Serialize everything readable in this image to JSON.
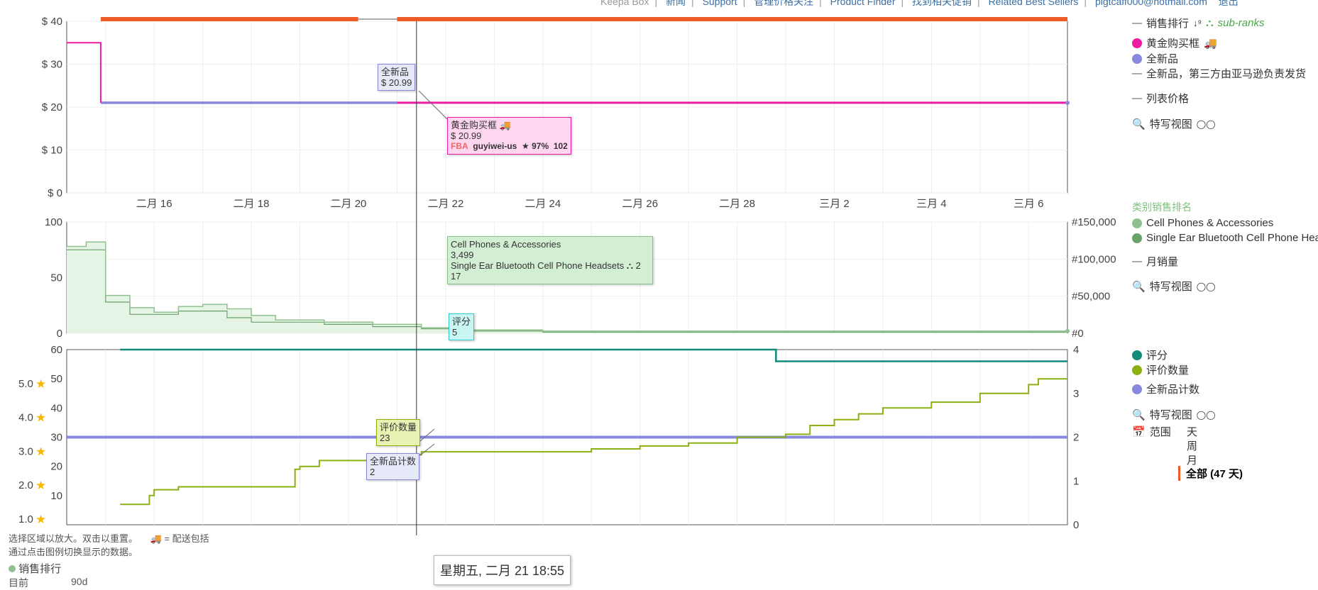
{
  "nav": {
    "items": [
      "Keepa Box",
      "新闻",
      "Support",
      "管理价格关注",
      "Product Finder",
      "找到相关促销",
      "Related Best Sellers",
      "pigtcaff000@hotmail.com",
      "退出"
    ]
  },
  "legend_price": {
    "sales_rank": "销售排行",
    "sub_ranks": "sub-ranks",
    "buy_box": "黄金购买框",
    "new": "全新品",
    "new_fba": "全新品，第三方由亚马逊负责发货",
    "list_price": "列表价格",
    "closeup": "特写视图"
  },
  "legend_rank": {
    "title": "类别销售排名",
    "cat1": "Cell Phones & Accessories",
    "cat2": "Single Ear Bluetooth Cell Phone Headsets",
    "monthly_sold": "月销量",
    "closeup": "特写视图"
  },
  "legend_rating": {
    "rating": "评分",
    "review_count": "评价数量",
    "new_offer_count": "全新品计数",
    "closeup": "特写视图",
    "range_label": "范围",
    "range_day": "天",
    "range_week": "周",
    "range_month": "月",
    "range_all": "全部 (47 天)"
  },
  "tooltips": {
    "new_title": "全新品",
    "new_price": "$ 20.99",
    "buybox_title": "黄金购买框",
    "buybox_price": "$ 20.99",
    "buybox_fba": "FBA",
    "buybox_seller": "guyiwei-us",
    "buybox_rating": "★ 97%",
    "buybox_count": "102",
    "rank_cat1": "Cell Phones & Accessories",
    "rank_cat1_value": "3,499",
    "rank_cat2": "Single Ear Bluetooth Cell Phone Headsets",
    "rank_cat2_badge": "2",
    "rank_cat2_value": "17",
    "rating_title": "评分",
    "rating_value": "5",
    "reviews_title": "评价数量",
    "reviews_value": "23",
    "offers_title": "全新品计数",
    "offers_value": "2",
    "date": "星期五, 二月 21 18:55"
  },
  "footer": {
    "hint1": "选择区域以放大。双击以重置。",
    "hint2": "= 配送包括",
    "hint3": "通过点击图例切换显示的数据。",
    "sales_rank": "销售排行",
    "current": "目前",
    "days90": "90d"
  },
  "colors": {
    "buy_box": "#ee1aa3",
    "new": "#8888dd",
    "amazon_bar": "#f05a28",
    "rank1": "#8fc18f",
    "rank2": "#6aa06a",
    "rating": "#138a7a",
    "review_count": "#8cb010",
    "offer_count": "#8888dd"
  },
  "chart_data": [
    {
      "type": "line",
      "title": "Price",
      "x_ticks": [
        "二月 16",
        "二月 18",
        "二月 20",
        "二月 22",
        "二月 24",
        "二月 26",
        "二月 28",
        "三月 2",
        "三月 4",
        "三月 6"
      ],
      "y_ticks": [
        "$ 0",
        "$ 10",
        "$ 20",
        "$ 30",
        "$ 40"
      ],
      "ylim": [
        0,
        40
      ],
      "xlim_days": [
        14.2,
        34.8
      ],
      "series": [
        {
          "name": "黄金购买框",
          "points": [
            [
              14.2,
              35
            ],
            [
              14.9,
              35
            ],
            [
              14.9,
              21
            ],
            [
              21,
              21
            ],
            [
              21.0,
              21
            ],
            [
              34.8,
              21
            ]
          ]
        },
        {
          "name": "全新品",
          "points": [
            [
              14.9,
              21
            ],
            [
              21,
              21
            ]
          ]
        }
      ],
      "amazon_bar_segments": [
        [
          14.9,
          20.2
        ],
        [
          21.0,
          34.8
        ]
      ]
    },
    {
      "type": "line",
      "title": "Sales Rank",
      "y_ticks_left": [
        "0",
        "50",
        "100"
      ],
      "y_ticks_right": [
        "#0",
        "#50,000",
        "#100,000",
        "#150,000"
      ],
      "ylim_left": [
        0,
        100
      ],
      "ylim_right": [
        0,
        150000
      ],
      "series": [
        {
          "name": "Cell Phones & Accessories",
          "points": [
            [
              14.2,
              78
            ],
            [
              14.6,
              78
            ],
            [
              14.6,
              82
            ],
            [
              15.0,
              82
            ],
            [
              15.0,
              34
            ],
            [
              15.5,
              34
            ],
            [
              15.5,
              23
            ],
            [
              16.0,
              23
            ],
            [
              16.0,
              19
            ],
            [
              16.5,
              19
            ],
            [
              16.5,
              24
            ],
            [
              17.0,
              24
            ],
            [
              17.0,
              26
            ],
            [
              17.5,
              26
            ],
            [
              17.5,
              22
            ],
            [
              18.0,
              22
            ],
            [
              18.0,
              16
            ],
            [
              18.5,
              16
            ],
            [
              18.5,
              12
            ],
            [
              19.5,
              12
            ],
            [
              19.5,
              10
            ],
            [
              20.5,
              10
            ],
            [
              20.5,
              8
            ],
            [
              21.5,
              8
            ],
            [
              21.5,
              5
            ],
            [
              22.5,
              5
            ],
            [
              22.5,
              3
            ],
            [
              24.0,
              3
            ],
            [
              24.0,
              2
            ],
            [
              34.8,
              2
            ]
          ]
        },
        {
          "name": "Single Ear Bluetooth Cell Phone Headsets",
          "points": [
            [
              14.2,
              75
            ],
            [
              15.0,
              75
            ],
            [
              15.0,
              28
            ],
            [
              15.5,
              28
            ],
            [
              15.5,
              17
            ],
            [
              16.5,
              17
            ],
            [
              16.5,
              20
            ],
            [
              17.5,
              20
            ],
            [
              17.5,
              14
            ],
            [
              18.0,
              14
            ],
            [
              18.0,
              10
            ],
            [
              19.5,
              10
            ],
            [
              19.5,
              8
            ],
            [
              20.5,
              8
            ],
            [
              20.5,
              6
            ],
            [
              21.5,
              6
            ],
            [
              21.5,
              4
            ],
            [
              22.5,
              4
            ],
            [
              22.5,
              2
            ],
            [
              24.0,
              2
            ],
            [
              24.0,
              1
            ],
            [
              34.8,
              1
            ]
          ]
        }
      ]
    },
    {
      "type": "line",
      "title": "Rating",
      "y_ticks_left": [
        "1.0",
        "2.0",
        "3.0",
        "4.0",
        "5.0"
      ],
      "y_ticks_mid": [
        "10",
        "20",
        "30",
        "40",
        "50",
        "60"
      ],
      "y_ticks_right": [
        "0",
        "1",
        "2",
        "3",
        "4"
      ],
      "ylim_mid": [
        0,
        60
      ],
      "ylim_right": [
        0,
        4
      ],
      "series": [
        {
          "name": "评分",
          "points": [
            [
              15.3,
              60
            ],
            [
              28.8,
              60
            ],
            [
              28.8,
              56
            ],
            [
              34.8,
              56
            ]
          ]
        },
        {
          "name": "评价数量",
          "points": [
            [
              15.3,
              7
            ],
            [
              15.9,
              7
            ],
            [
              15.9,
              10
            ],
            [
              16.0,
              10
            ],
            [
              16.0,
              12
            ],
            [
              16.5,
              12
            ],
            [
              16.5,
              13
            ],
            [
              18.9,
              13
            ],
            [
              18.9,
              19
            ],
            [
              19.0,
              19
            ],
            [
              19.0,
              20
            ],
            [
              19.4,
              20
            ],
            [
              19.4,
              22
            ],
            [
              20.4,
              22
            ],
            [
              20.4,
              23
            ],
            [
              21.3,
              23
            ],
            [
              21.3,
              24
            ],
            [
              21.5,
              24
            ],
            [
              21.5,
              25
            ],
            [
              25.0,
              25
            ],
            [
              25.0,
              26
            ],
            [
              26.0,
              26
            ],
            [
              26.0,
              27
            ],
            [
              27.0,
              27
            ],
            [
              27.0,
              28
            ],
            [
              28.0,
              28
            ],
            [
              28.0,
              30
            ],
            [
              29.0,
              30
            ],
            [
              29.0,
              31
            ],
            [
              29.5,
              31
            ],
            [
              29.5,
              34
            ],
            [
              30.0,
              34
            ],
            [
              30.0,
              36
            ],
            [
              30.5,
              36
            ],
            [
              30.5,
              38
            ],
            [
              31.0,
              38
            ],
            [
              31.0,
              40
            ],
            [
              32.0,
              40
            ],
            [
              32.0,
              42
            ],
            [
              33.0,
              42
            ],
            [
              33.0,
              45
            ],
            [
              34.0,
              45
            ],
            [
              34.0,
              48
            ],
            [
              34.2,
              48
            ],
            [
              34.2,
              50
            ],
            [
              34.8,
              50
            ]
          ]
        },
        {
          "name": "全新品计数",
          "points": [
            [
              14.2,
              30
            ],
            [
              34.8,
              30
            ]
          ]
        }
      ]
    }
  ]
}
